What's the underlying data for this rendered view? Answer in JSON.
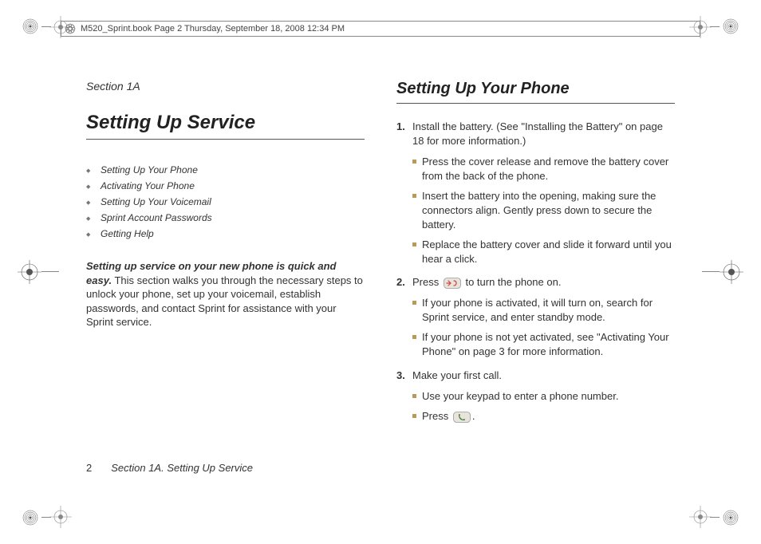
{
  "header": {
    "text": "M520_Sprint.book  Page 2  Thursday, September 18, 2008  12:34 PM"
  },
  "left": {
    "section_label": "Section 1A",
    "title": "Setting Up Service",
    "toc": [
      "Setting Up Your Phone",
      "Activating Your Phone",
      "Setting Up Your Voicemail",
      "Sprint Account Passwords",
      "Getting Help"
    ],
    "intro_lead": "Setting up service on your new phone is quick and easy.",
    "intro_rest": " This section walks you through the necessary steps to unlock your phone, set up your voicemail, establish passwords, and contact Sprint for assistance with your Sprint service."
  },
  "right": {
    "title": "Setting Up Your Phone",
    "step1_num": "1.",
    "step1_text": "Install the battery. (See \"Installing the Battery\" on page 18 for more information.)",
    "step1_sub": [
      "Press the cover release and remove the battery cover from the back of the phone.",
      "Insert the battery into the opening, making sure the connectors align. Gently press down to secure the battery.",
      "Replace the battery cover and slide it forward until you hear a click."
    ],
    "step2_num": "2.",
    "step2_pre": "Press ",
    "step2_post": " to turn the phone on.",
    "step2_sub": [
      "If your phone is activated, it will turn on, search for Sprint service, and enter standby mode.",
      "If your phone is not yet activated, see \"Activating Your Phone\" on page 3 for more information."
    ],
    "step3_num": "3.",
    "step3_text": "Make your first call.",
    "step3_sub1": "Use your keypad to enter a phone number.",
    "step3_sub2_pre": "Press ",
    "step3_sub2_post": "."
  },
  "footer": {
    "page": "2",
    "text": "Section 1A. Setting Up Service"
  }
}
